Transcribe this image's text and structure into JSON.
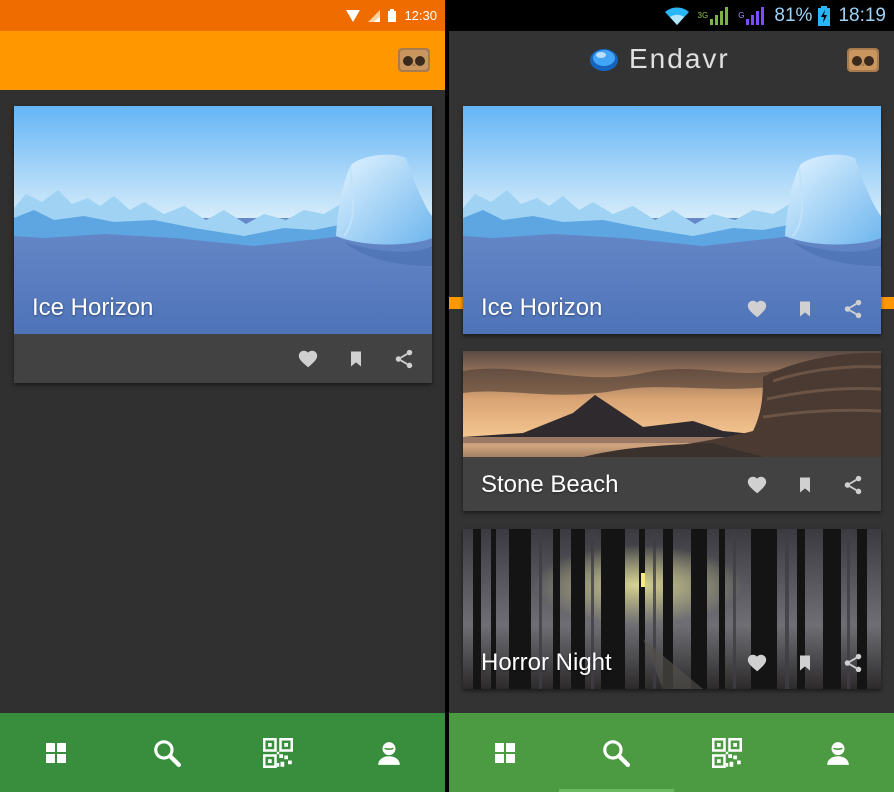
{
  "left_screen": {
    "status": {
      "time": "12:30"
    },
    "colors": {
      "statusbar": "#ef6c00",
      "toolbar": "#ff9800",
      "bottomnav": "#388e3c"
    },
    "cards": [
      {
        "title": "Ice Horizon",
        "image": "ice-panorama"
      }
    ],
    "bottom_nav": [
      "grid-icon",
      "search-icon",
      "qr-code-icon",
      "profile-icon"
    ]
  },
  "right_screen": {
    "status": {
      "network": "3G",
      "network2": "G",
      "battery": "81%",
      "time": "18:19"
    },
    "app_title": "Endavr",
    "colors": {
      "statusbar": "#000000",
      "toolbar": "#333333",
      "bottomnav": "#4c9a42"
    },
    "cards": [
      {
        "title": "Ice Horizon",
        "image": "ice-panorama"
      },
      {
        "title": "Stone Beach",
        "image": "stone-beach-panorama"
      },
      {
        "title": "Horror Night",
        "image": "dark-forest-panorama"
      }
    ],
    "bottom_nav": [
      "grid-icon",
      "search-icon",
      "qr-code-icon",
      "profile-icon"
    ],
    "selected_nav": "search"
  }
}
